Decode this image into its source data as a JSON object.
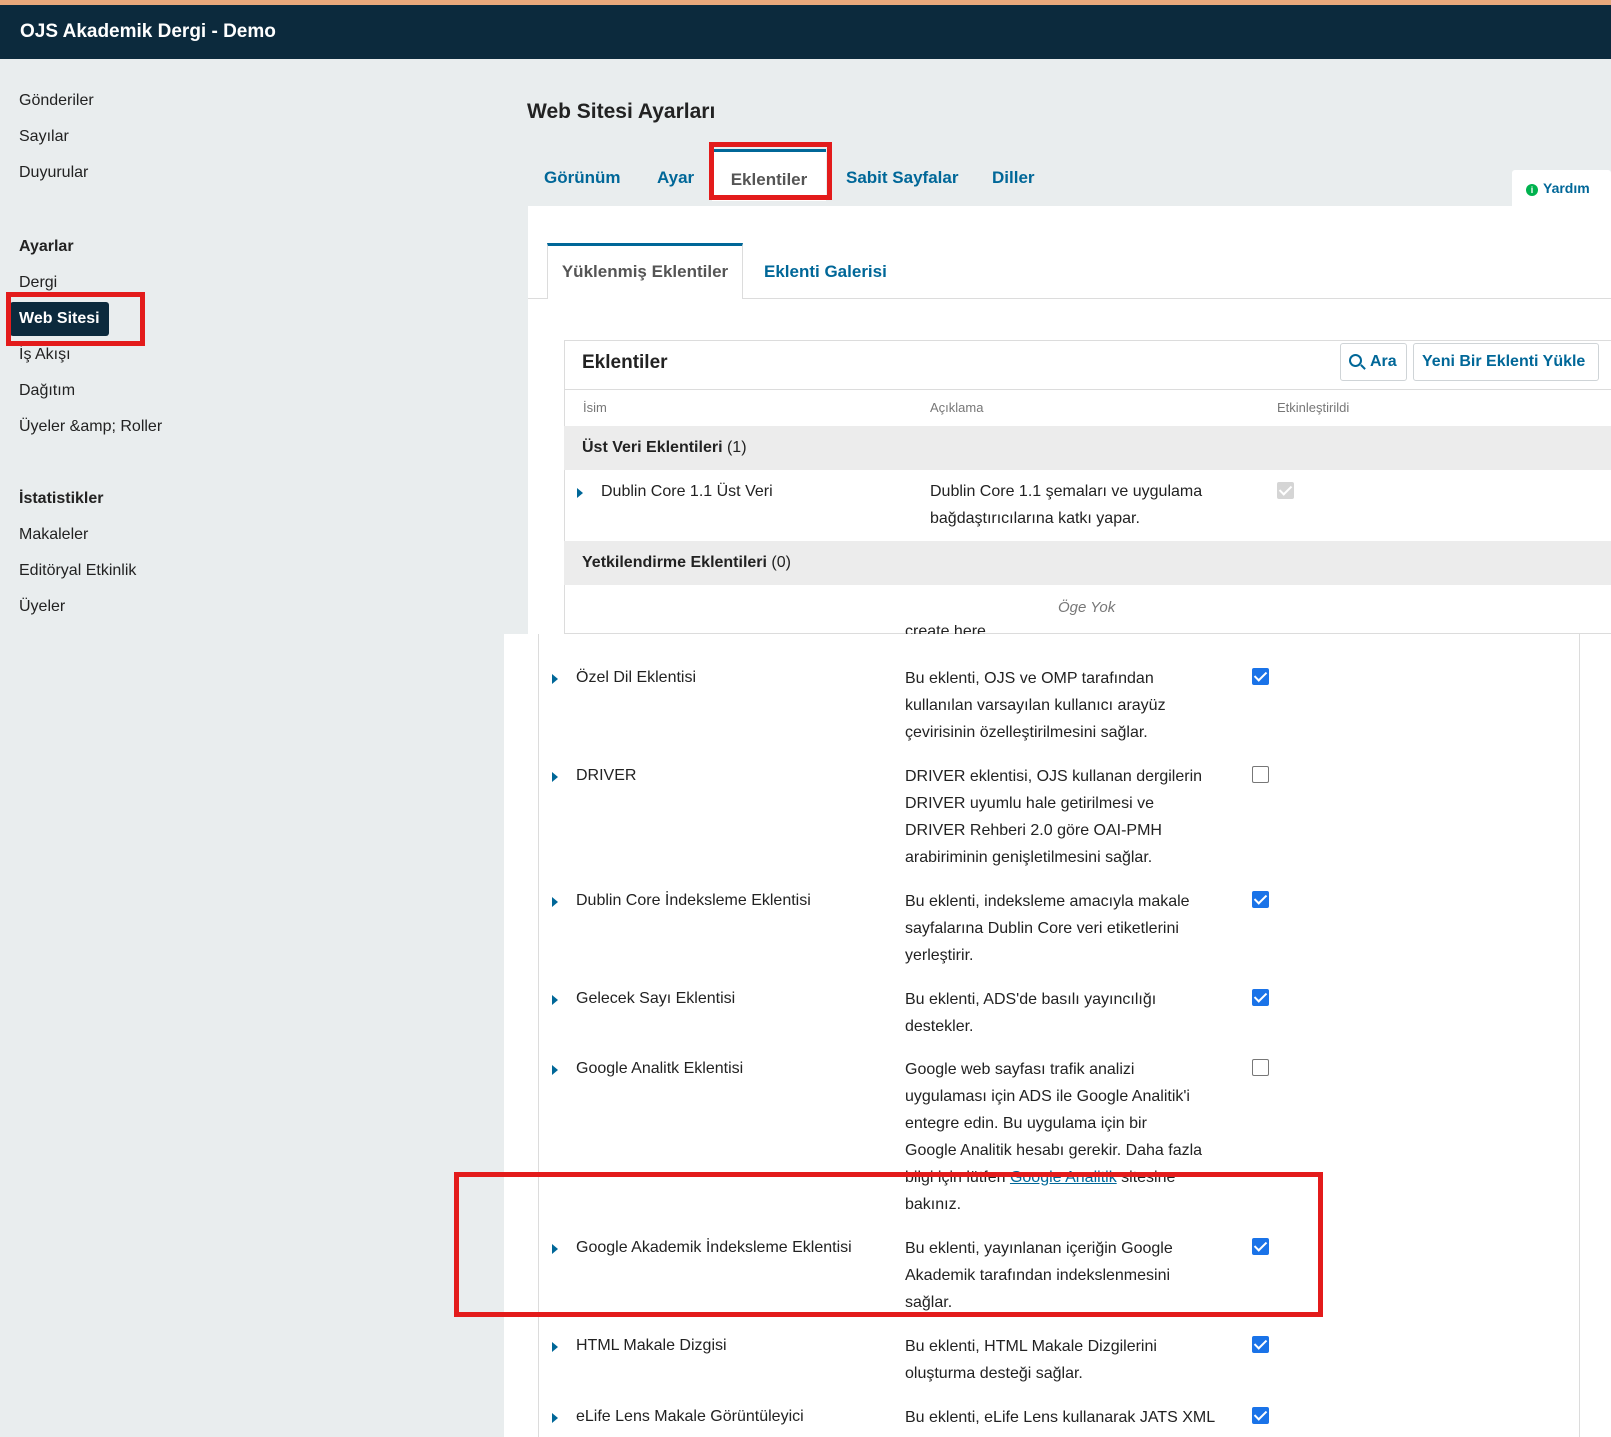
{
  "header": {
    "title": "OJS Akademik Dergi - Demo"
  },
  "sidebar": {
    "nav": [
      "Gönderiler",
      "Sayılar",
      "Duyurular"
    ],
    "settings_heading": "Ayarlar",
    "settings": [
      "Dergi",
      "Web Sitesi",
      "İş Akışı",
      "Dağıtım",
      "Üyeler &amp; Roller"
    ],
    "stats_heading": "İstatistikler",
    "stats": [
      "Makaleler",
      "Editöryal Etkinlik",
      "Üyeler"
    ]
  },
  "page": {
    "title": "Web Sitesi Ayarları",
    "tabs": [
      "Görünüm",
      "Ayar",
      "Eklentiler",
      "Sabit Sayfalar",
      "Diller"
    ],
    "help": "Yardım",
    "subtabs": [
      "Yüklenmiş Eklentiler",
      "Eklenti Galerisi"
    ]
  },
  "grid": {
    "title": "Eklentiler",
    "search": "Ara",
    "upload": "Yeni Bir Eklenti Yükle",
    "columns": [
      "İsim",
      "Açıklama",
      "Etkinleştirildi"
    ],
    "cat1": {
      "name": "Üst Veri Eklentileri",
      "count": "(1)"
    },
    "cat2": {
      "name": "Yetkilendirme Eklentileri",
      "count": "(0)"
    },
    "empty": "Öge Yok",
    "cut_text": "create here."
  },
  "plugins": [
    {
      "name": "Dublin Core 1.1 Üst Veri",
      "desc": [
        "Dublin Core 1.1 şemaları ve uygulama",
        "bağdaştırıcılarına katkı yapar."
      ],
      "enabled": true
    },
    {
      "name": "Özel Dil Eklentisi",
      "desc": [
        "Bu eklenti, OJS ve OMP tarafından",
        "kullanılan varsayılan kullanıcı arayüz",
        "çevirisinin özelleştirilmesini sağlar."
      ],
      "enabled": true
    },
    {
      "name": "DRIVER",
      "desc": [
        "DRIVER eklentisi, OJS kullanan dergilerin",
        "DRIVER uyumlu hale getirilmesi ve",
        "DRIVER Rehberi 2.0 göre OAI-PMH",
        "arabiriminin genişletilmesini sağlar."
      ],
      "enabled": false
    },
    {
      "name": "Dublin Core İndeksleme Eklentisi",
      "desc": [
        "Bu eklenti, indeksleme amacıyla makale",
        "sayfalarına Dublin Core veri etiketlerini",
        "yerleştirir."
      ],
      "enabled": true
    },
    {
      "name": "Gelecek Sayı Eklentisi",
      "desc": [
        "Bu eklenti, ADS'de basılı yayıncılığı",
        "destekler."
      ],
      "enabled": true
    },
    {
      "name": "Google Analitk Eklentisi",
      "desc": [
        "Google web sayfası trafik analizi",
        "uygulaması için ADS ile Google Analitik'i",
        "entegre edin. Bu uygulama için bir",
        "Google Analitik hesabı gerekir. Daha fazla"
      ],
      "desc_pre": "bilgi için lütfen ",
      "desc_link": "Google Analitik",
      "desc_post": " sitesine",
      "desc_end": "bakınız.",
      "enabled": false
    },
    {
      "name": "Google Akademik İndeksleme Eklentisi",
      "desc": [
        "Bu eklenti, yayınlanan içeriğin Google",
        "Akademik tarafından indekslenmesini",
        "sağlar."
      ],
      "enabled": true
    },
    {
      "name": "HTML Makale Dizgisi",
      "desc": [
        "Bu eklenti, HTML Makale Dizgilerini",
        "oluşturma desteği sağlar."
      ],
      "enabled": true
    },
    {
      "name": "eLife Lens Makale Görüntüleyici",
      "desc": [
        "Bu eklenti, eLife Lens kullanarak JATS XML"
      ],
      "enabled": true
    }
  ],
  "colors": {
    "brand": "#0c2a3d",
    "accent": "#006798",
    "highlight": "#e31b1b",
    "checkbox": "#1a73e8"
  }
}
